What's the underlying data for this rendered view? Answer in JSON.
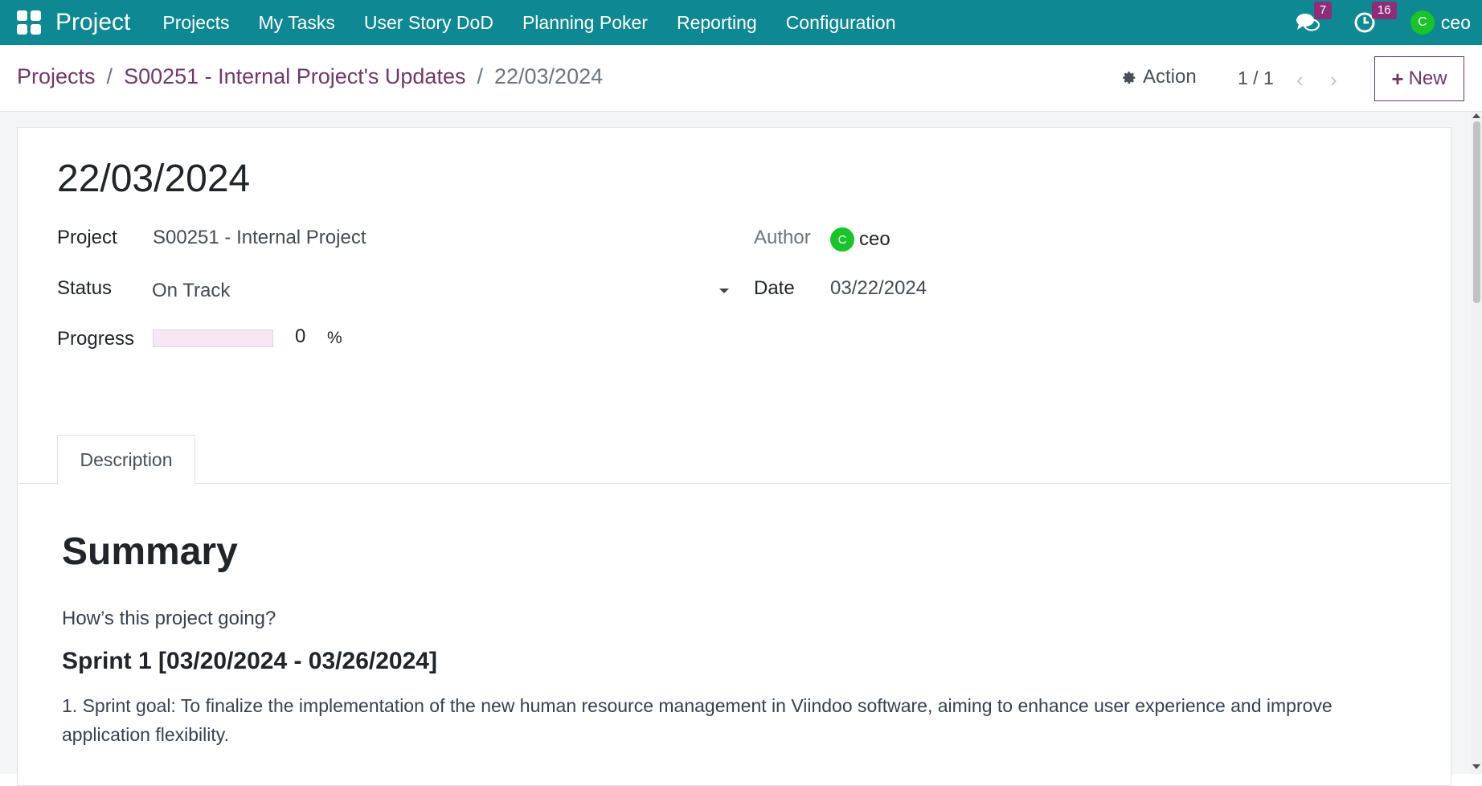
{
  "topbar": {
    "app_name": "Project",
    "menu": [
      "Projects",
      "My Tasks",
      "User Story DoD",
      "Planning Poker",
      "Reporting",
      "Configuration"
    ],
    "messages_badge": "7",
    "activities_badge": "16",
    "user_initial": "C",
    "user_name": "ceo",
    "bg_color": "#0e8892"
  },
  "breadcrumb": {
    "root": "Projects",
    "sep": "/",
    "parent": "S00251 - Internal Project's Updates",
    "current": "22/03/2024"
  },
  "control": {
    "action_label": "Action",
    "pager": "1 / 1",
    "prev": "‹",
    "next": "›",
    "new_label": "New",
    "new_plus": "+"
  },
  "record": {
    "title": "22/03/2024",
    "project_label": "Project",
    "project_value": "S00251 - Internal Project",
    "status_label": "Status",
    "status_value": "On Track",
    "progress_label": "Progress",
    "progress_value": "0",
    "progress_unit": "%",
    "progress_fraction": 0,
    "author_label": "Author",
    "author_initial": "C",
    "author_name": "ceo",
    "date_label": "Date",
    "date_value": "03/22/2024"
  },
  "tabs": {
    "description": "Description"
  },
  "description": {
    "heading": "Summary",
    "question": "How’s this project going?",
    "sprint_title": "Sprint 1 [03/20/2024 - 03/26/2024]",
    "goal": "1. Sprint goal: To finalize the implementation of the new human resource management in Viindoo software, aiming to enhance user experience and improve application flexibility."
  }
}
